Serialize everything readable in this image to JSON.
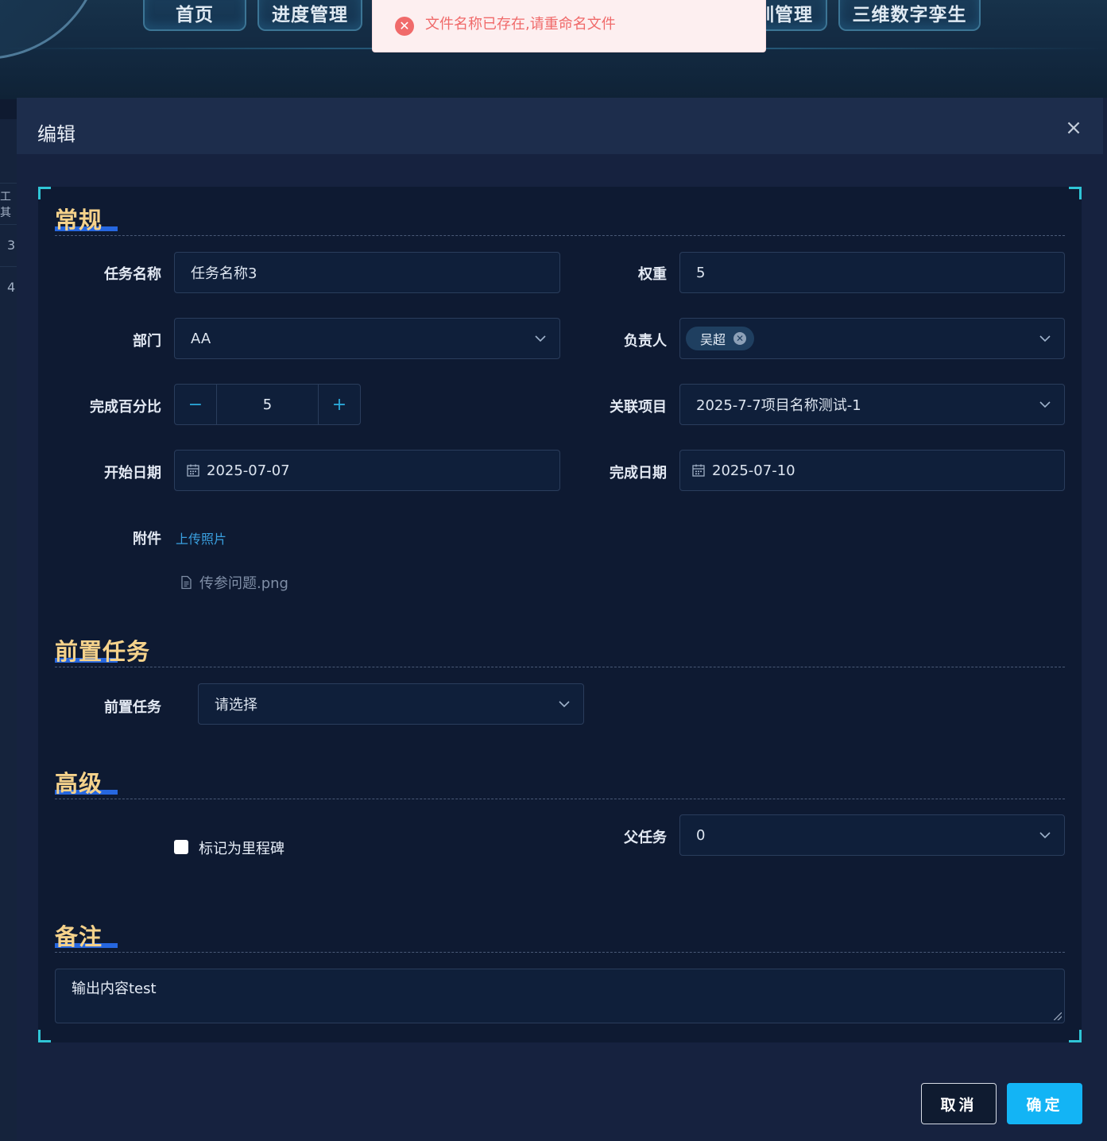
{
  "nav": {
    "tabs": [
      {
        "label": "首页"
      },
      {
        "label": "进度管理"
      },
      {
        "label": "训管理"
      },
      {
        "label": "三维数字孪生"
      }
    ]
  },
  "side": {
    "header": "工其",
    "row1": "3",
    "row2": "4"
  },
  "toast": {
    "icon": "error-circle-icon",
    "message": "文件名称已存在,请重命名文件",
    "color": "#f06a6a"
  },
  "dialog": {
    "title": "编辑",
    "close": "×",
    "sections": {
      "general": "常规",
      "predecessor": "前置任务",
      "advanced": "高级",
      "remarks": "备注"
    },
    "fields": {
      "task_name": {
        "label": "任务名称",
        "value": "任务名称3"
      },
      "weight": {
        "label": "权重",
        "value": "5"
      },
      "department": {
        "label": "部门",
        "value": "AA"
      },
      "owner": {
        "label": "负责人",
        "tag": "吴超"
      },
      "percent": {
        "label": "完成百分比",
        "value": "5",
        "minus": "−",
        "plus": "+"
      },
      "project": {
        "label": "关联项目",
        "value": "2025-7-7项目名称测试-1"
      },
      "start_date": {
        "label": "开始日期",
        "value": "2025-07-07"
      },
      "end_date": {
        "label": "完成日期",
        "value": "2025-07-10"
      },
      "attachment": {
        "label": "附件",
        "upload_link": "上传照片",
        "file": "传参问题.png"
      },
      "predecessor_task": {
        "label": "前置任务",
        "placeholder": "请选择"
      },
      "milestone": {
        "label": "标记为里程碑",
        "checked": false
      },
      "parent_task": {
        "label": "父任务",
        "value": "0"
      },
      "remarks": {
        "value": "输出内容test"
      }
    },
    "buttons": {
      "cancel": "取消",
      "ok": "确定"
    },
    "accent_color": "#13b4f5",
    "section_title_color": "#f5d28b"
  }
}
